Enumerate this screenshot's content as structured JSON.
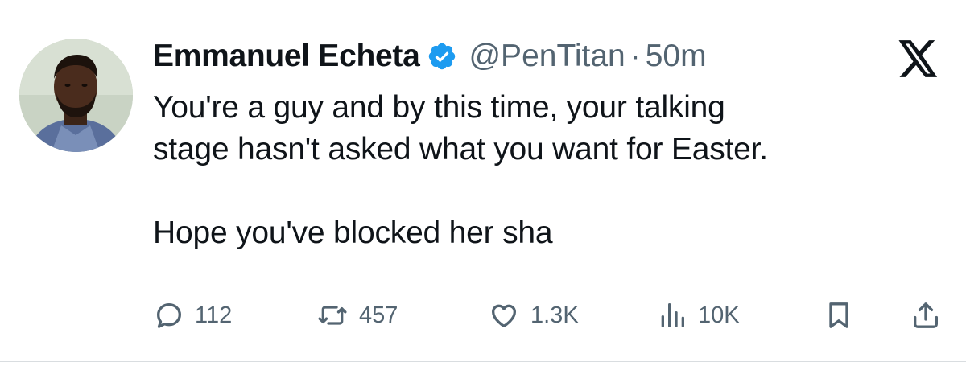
{
  "author": {
    "display_name": "Emmanuel Echeta",
    "handle": "@PenTitan",
    "separator": "·",
    "time": "50m",
    "verified_color": "#1d9bf0"
  },
  "tweet": {
    "line1": "You're a guy and by this time, your talking",
    "line2": "stage hasn't asked what you want for Easter.",
    "line3": "Hope you've blocked her sha"
  },
  "actions": {
    "replies": "112",
    "retweets": "457",
    "likes": "1.3K",
    "views": "10K"
  },
  "icons": {
    "brand": "x-logo-icon",
    "reply": "reply-icon",
    "retweet": "retweet-icon",
    "like": "heart-icon",
    "views": "views-icon",
    "bookmark": "bookmark-icon",
    "share": "share-icon"
  },
  "colors": {
    "text": "#0f1419",
    "secondary": "#536471",
    "divider": "#d9dde0"
  }
}
